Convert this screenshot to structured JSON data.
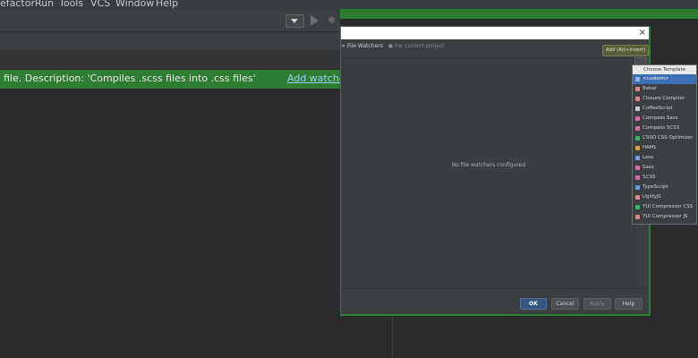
{
  "menubar": {
    "items": [
      "efactor",
      "Run",
      "Tools",
      "VCS",
      "Window",
      "Help"
    ]
  },
  "notification": {
    "text": "file. Description: 'Compiles .scss files into .css files'",
    "action": "Add watcher"
  },
  "dialog": {
    "close": "×",
    "breadcrumb_prefix": ">",
    "breadcrumb": "File Watchers",
    "breadcrumb_sub": "For current project",
    "add_button": "Add (Alt+Insert)",
    "empty_text": "No file watchers configured",
    "buttons": {
      "ok": "OK",
      "cancel": "Cancel",
      "apply": "Apply",
      "help": "Help"
    }
  },
  "popup": {
    "header": "Choose Template",
    "items": [
      {
        "label": "<custom>",
        "icon": "file-icon",
        "color": "#8fb8e8"
      },
      {
        "label": "Babel",
        "icon": "watcher-icon",
        "color": "#d88a8a"
      },
      {
        "label": "Closure Compiler",
        "icon": "watcher-icon",
        "color": "#d88a8a"
      },
      {
        "label": "CoffeeScript",
        "icon": "coffee-icon",
        "color": "#cfcfcf"
      },
      {
        "label": "Compass Sass",
        "icon": "sass-icon",
        "color": "#d36fa4"
      },
      {
        "label": "Compass SCSS",
        "icon": "sass-icon",
        "color": "#d36fa4"
      },
      {
        "label": "CSSO CSS Optimizer",
        "icon": "css-icon",
        "color": "#3fb56b"
      },
      {
        "label": "HAML",
        "icon": "haml-icon",
        "color": "#e0a050"
      },
      {
        "label": "Less",
        "icon": "less-icon",
        "color": "#7aa0d8"
      },
      {
        "label": "Sass",
        "icon": "sass-icon",
        "color": "#d36fa4"
      },
      {
        "label": "SCSS",
        "icon": "sass-icon",
        "color": "#d36fa4"
      },
      {
        "label": "TypeScript",
        "icon": "typescript-icon",
        "color": "#6a9fd8"
      },
      {
        "label": "UglifyJS",
        "icon": "watcher-icon",
        "color": "#d88a8a"
      },
      {
        "label": "YUI Compressor CSS",
        "icon": "css-icon",
        "color": "#3fb56b"
      },
      {
        "label": "YUI Compressor JS",
        "icon": "watcher-icon",
        "color": "#d88a8a"
      }
    ]
  }
}
